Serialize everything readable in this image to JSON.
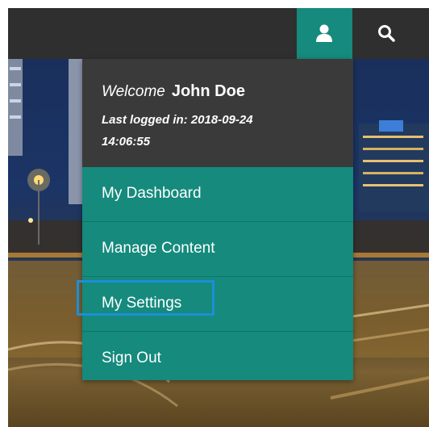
{
  "header": {
    "user_icon": "user-icon",
    "search_icon": "search-icon",
    "accent_color": "#158a7d"
  },
  "dropdown": {
    "welcome_text": "Welcome",
    "user_name": "John Doe",
    "last_logged_in": "Last logged in: 2018-09-24 14:06:55",
    "items": [
      {
        "label": "My Dashboard"
      },
      {
        "label": "Manage Content"
      },
      {
        "label": "My Settings"
      },
      {
        "label": "Sign Out"
      }
    ],
    "highlighted_item": "My Settings"
  }
}
